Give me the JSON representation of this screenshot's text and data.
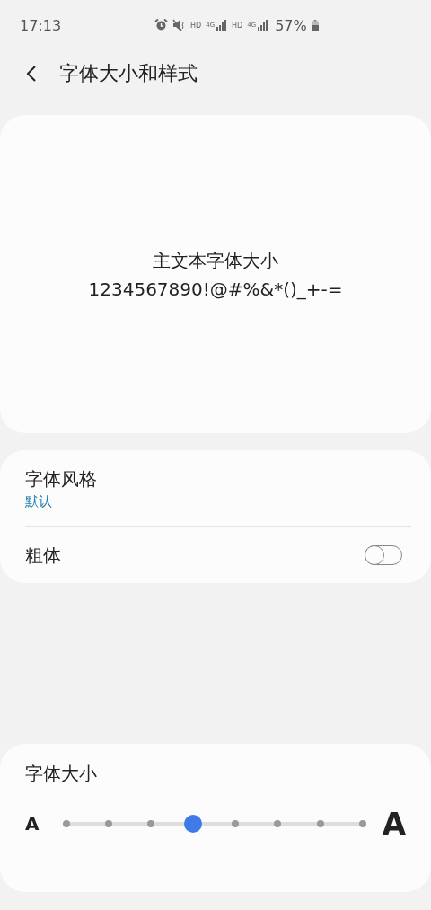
{
  "status_bar": {
    "time": "17:13",
    "indicators": [
      {
        "kind": "alarm"
      },
      {
        "kind": "mute"
      },
      {
        "kind": "text",
        "text": "HD"
      },
      {
        "kind": "network",
        "text": "4G"
      },
      {
        "kind": "signal"
      },
      {
        "kind": "text",
        "text": "HD"
      },
      {
        "kind": "network",
        "text": "4G"
      },
      {
        "kind": "signal"
      }
    ],
    "battery": "57%"
  },
  "header": {
    "title": "字体大小和样式"
  },
  "preview": {
    "lines": [
      "主文本字体大小",
      "1234567890!@#%&*()_+-="
    ]
  },
  "style_card": {
    "items": [
      {
        "kind": "value",
        "title": "字体风格",
        "value": "默认"
      },
      {
        "kind": "switch",
        "title": "粗体",
        "on": false
      }
    ]
  },
  "size_card": {
    "title": "字体大小",
    "small_label": "A",
    "large_label": "A",
    "level": 0.4286
  }
}
